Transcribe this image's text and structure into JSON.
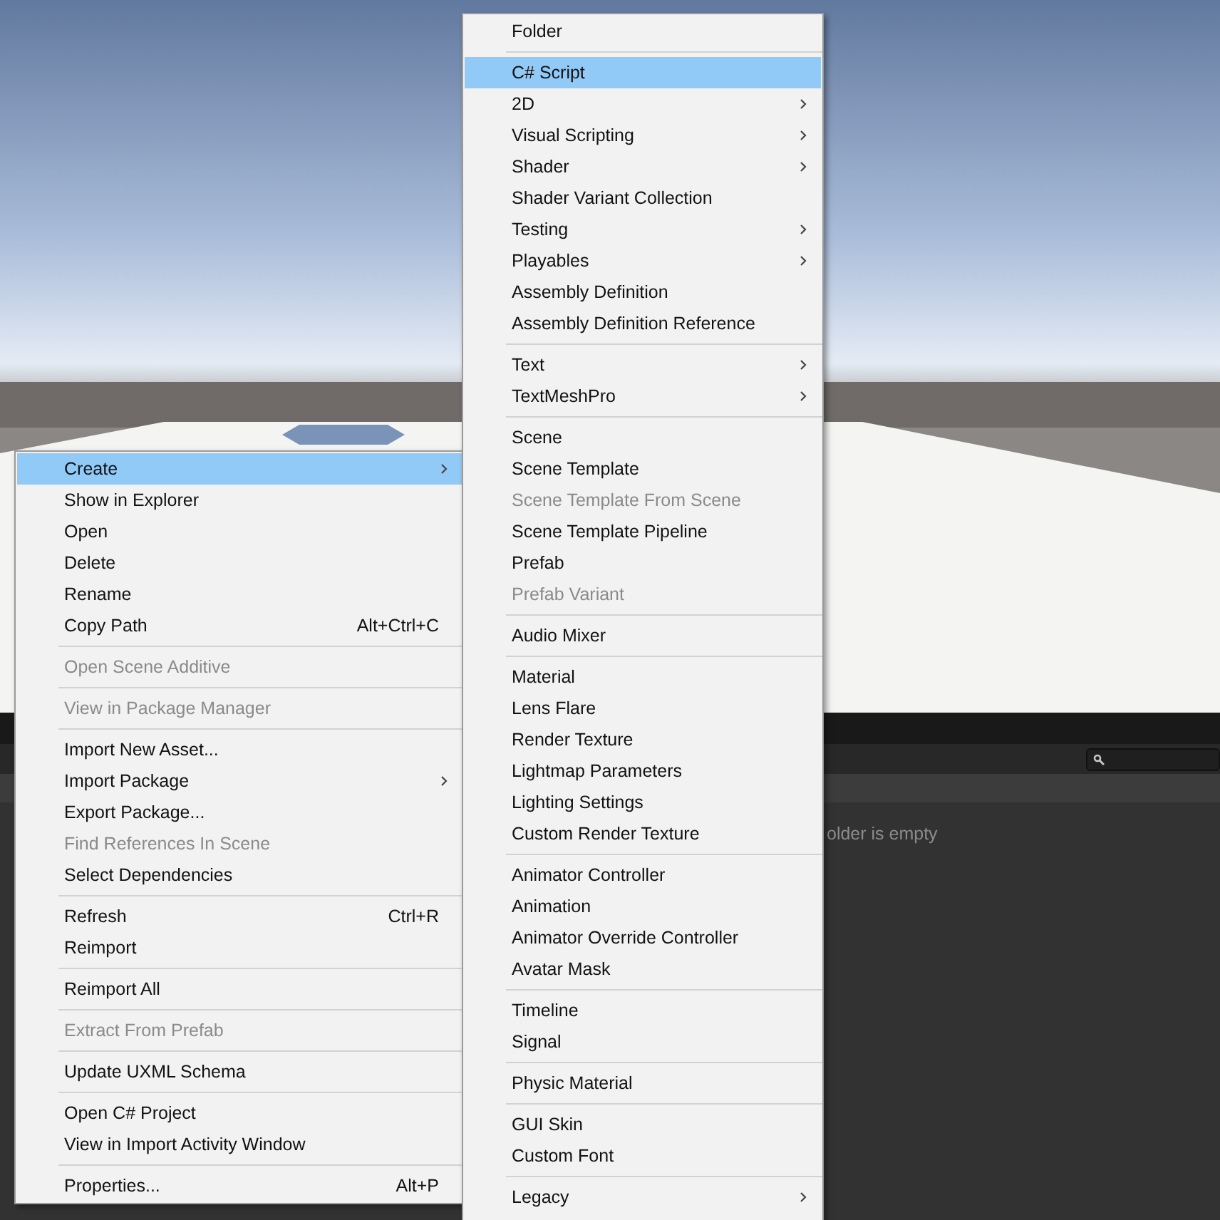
{
  "project_panel": {
    "empty_message": "older is empty"
  },
  "menus": [
    {
      "items": [
        {
          "kind": "item",
          "label": "Create",
          "submenu": true,
          "disabled": false,
          "selected": true
        },
        {
          "kind": "item",
          "label": "Show in Explorer",
          "submenu": false,
          "disabled": false,
          "selected": false
        },
        {
          "kind": "item",
          "label": "Open",
          "submenu": false,
          "disabled": false,
          "selected": false
        },
        {
          "kind": "item",
          "label": "Delete",
          "submenu": false,
          "disabled": false,
          "selected": false
        },
        {
          "kind": "item",
          "label": "Rename",
          "submenu": false,
          "disabled": false,
          "selected": false
        },
        {
          "kind": "item",
          "label": "Copy Path",
          "shortcut": "Alt+Ctrl+C",
          "submenu": false,
          "disabled": false,
          "selected": false
        },
        {
          "kind": "separator"
        },
        {
          "kind": "item",
          "label": "Open Scene Additive",
          "submenu": false,
          "disabled": true,
          "selected": false
        },
        {
          "kind": "separator"
        },
        {
          "kind": "item",
          "label": "View in Package Manager",
          "submenu": false,
          "disabled": true,
          "selected": false
        },
        {
          "kind": "separator"
        },
        {
          "kind": "item",
          "label": "Import New Asset...",
          "submenu": false,
          "disabled": false,
          "selected": false
        },
        {
          "kind": "item",
          "label": "Import Package",
          "submenu": true,
          "disabled": false,
          "selected": false
        },
        {
          "kind": "item",
          "label": "Export Package...",
          "submenu": false,
          "disabled": false,
          "selected": false
        },
        {
          "kind": "item",
          "label": "Find References In Scene",
          "submenu": false,
          "disabled": true,
          "selected": false
        },
        {
          "kind": "item",
          "label": "Select Dependencies",
          "submenu": false,
          "disabled": false,
          "selected": false
        },
        {
          "kind": "separator"
        },
        {
          "kind": "item",
          "label": "Refresh",
          "shortcut": "Ctrl+R",
          "submenu": false,
          "disabled": false,
          "selected": false
        },
        {
          "kind": "item",
          "label": "Reimport",
          "submenu": false,
          "disabled": false,
          "selected": false
        },
        {
          "kind": "separator"
        },
        {
          "kind": "item",
          "label": "Reimport All",
          "submenu": false,
          "disabled": false,
          "selected": false
        },
        {
          "kind": "separator"
        },
        {
          "kind": "item",
          "label": "Extract From Prefab",
          "submenu": false,
          "disabled": true,
          "selected": false
        },
        {
          "kind": "separator"
        },
        {
          "kind": "item",
          "label": "Update UXML Schema",
          "submenu": false,
          "disabled": false,
          "selected": false
        },
        {
          "kind": "separator"
        },
        {
          "kind": "item",
          "label": "Open C# Project",
          "submenu": false,
          "disabled": false,
          "selected": false
        },
        {
          "kind": "item",
          "label": "View in Import Activity Window",
          "submenu": false,
          "disabled": false,
          "selected": false
        },
        {
          "kind": "separator"
        },
        {
          "kind": "item",
          "label": "Properties...",
          "shortcut": "Alt+P",
          "submenu": false,
          "disabled": false,
          "selected": false
        }
      ]
    },
    {
      "items": [
        {
          "kind": "item",
          "label": "Folder",
          "submenu": false,
          "disabled": false,
          "selected": false
        },
        {
          "kind": "separator"
        },
        {
          "kind": "item",
          "label": "C# Script",
          "submenu": false,
          "disabled": false,
          "selected": true
        },
        {
          "kind": "item",
          "label": "2D",
          "submenu": true,
          "disabled": false,
          "selected": false
        },
        {
          "kind": "item",
          "label": "Visual Scripting",
          "submenu": true,
          "disabled": false,
          "selected": false
        },
        {
          "kind": "item",
          "label": "Shader",
          "submenu": true,
          "disabled": false,
          "selected": false
        },
        {
          "kind": "item",
          "label": "Shader Variant Collection",
          "submenu": false,
          "disabled": false,
          "selected": false
        },
        {
          "kind": "item",
          "label": "Testing",
          "submenu": true,
          "disabled": false,
          "selected": false
        },
        {
          "kind": "item",
          "label": "Playables",
          "submenu": true,
          "disabled": false,
          "selected": false
        },
        {
          "kind": "item",
          "label": "Assembly Definition",
          "submenu": false,
          "disabled": false,
          "selected": false
        },
        {
          "kind": "item",
          "label": "Assembly Definition Reference",
          "submenu": false,
          "disabled": false,
          "selected": false
        },
        {
          "kind": "separator"
        },
        {
          "kind": "item",
          "label": "Text",
          "submenu": true,
          "disabled": false,
          "selected": false
        },
        {
          "kind": "item",
          "label": "TextMeshPro",
          "submenu": true,
          "disabled": false,
          "selected": false
        },
        {
          "kind": "separator"
        },
        {
          "kind": "item",
          "label": "Scene",
          "submenu": false,
          "disabled": false,
          "selected": false
        },
        {
          "kind": "item",
          "label": "Scene Template",
          "submenu": false,
          "disabled": false,
          "selected": false
        },
        {
          "kind": "item",
          "label": "Scene Template From Scene",
          "submenu": false,
          "disabled": true,
          "selected": false
        },
        {
          "kind": "item",
          "label": "Scene Template Pipeline",
          "submenu": false,
          "disabled": false,
          "selected": false
        },
        {
          "kind": "item",
          "label": "Prefab",
          "submenu": false,
          "disabled": false,
          "selected": false
        },
        {
          "kind": "item",
          "label": "Prefab Variant",
          "submenu": false,
          "disabled": true,
          "selected": false
        },
        {
          "kind": "separator"
        },
        {
          "kind": "item",
          "label": "Audio Mixer",
          "submenu": false,
          "disabled": false,
          "selected": false
        },
        {
          "kind": "separator"
        },
        {
          "kind": "item",
          "label": "Material",
          "submenu": false,
          "disabled": false,
          "selected": false
        },
        {
          "kind": "item",
          "label": "Lens Flare",
          "submenu": false,
          "disabled": false,
          "selected": false
        },
        {
          "kind": "item",
          "label": "Render Texture",
          "submenu": false,
          "disabled": false,
          "selected": false
        },
        {
          "kind": "item",
          "label": "Lightmap Parameters",
          "submenu": false,
          "disabled": false,
          "selected": false
        },
        {
          "kind": "item",
          "label": "Lighting Settings",
          "submenu": false,
          "disabled": false,
          "selected": false
        },
        {
          "kind": "item",
          "label": "Custom Render Texture",
          "submenu": false,
          "disabled": false,
          "selected": false
        },
        {
          "kind": "separator"
        },
        {
          "kind": "item",
          "label": "Animator Controller",
          "submenu": false,
          "disabled": false,
          "selected": false
        },
        {
          "kind": "item",
          "label": "Animation",
          "submenu": false,
          "disabled": false,
          "selected": false
        },
        {
          "kind": "item",
          "label": "Animator Override Controller",
          "submenu": false,
          "disabled": false,
          "selected": false
        },
        {
          "kind": "item",
          "label": "Avatar Mask",
          "submenu": false,
          "disabled": false,
          "selected": false
        },
        {
          "kind": "separator"
        },
        {
          "kind": "item",
          "label": "Timeline",
          "submenu": false,
          "disabled": false,
          "selected": false
        },
        {
          "kind": "item",
          "label": "Signal",
          "submenu": false,
          "disabled": false,
          "selected": false
        },
        {
          "kind": "separator"
        },
        {
          "kind": "item",
          "label": "Physic Material",
          "submenu": false,
          "disabled": false,
          "selected": false
        },
        {
          "kind": "separator"
        },
        {
          "kind": "item",
          "label": "GUI Skin",
          "submenu": false,
          "disabled": false,
          "selected": false
        },
        {
          "kind": "item",
          "label": "Custom Font",
          "submenu": false,
          "disabled": false,
          "selected": false
        },
        {
          "kind": "separator"
        },
        {
          "kind": "item",
          "label": "Legacy",
          "submenu": true,
          "disabled": false,
          "selected": false
        }
      ]
    }
  ]
}
